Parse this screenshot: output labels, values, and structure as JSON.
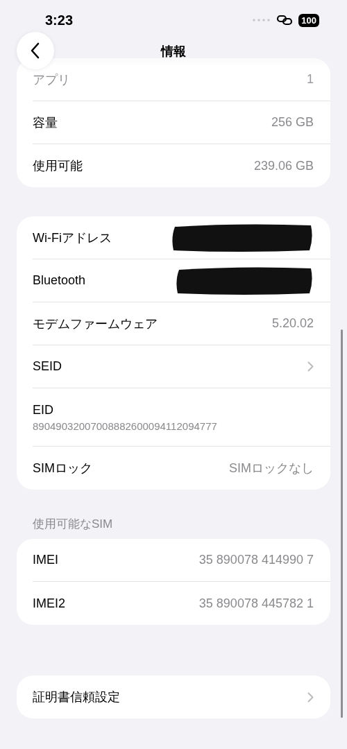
{
  "status_bar": {
    "time": "3:23",
    "battery": "100"
  },
  "nav": {
    "title": "情報"
  },
  "groups": [
    {
      "rows": [
        {
          "kind": "value",
          "label": "アプリ",
          "value": "1",
          "dimmed": true
        },
        {
          "kind": "value",
          "label": "容量",
          "value": "256 GB",
          "dimmed": false
        },
        {
          "kind": "value",
          "label": "使用可能",
          "value": "239.06 GB",
          "dimmed": false
        }
      ]
    },
    {
      "rows": [
        {
          "kind": "redacted",
          "label": "Wi-Fiアドレス",
          "dimmed": false
        },
        {
          "kind": "redacted",
          "label": "Bluetooth",
          "dimmed": false
        },
        {
          "kind": "value",
          "label": "モデムファームウェア",
          "value": "5.20.02",
          "dimmed": false
        },
        {
          "kind": "chevron",
          "label": "SEID",
          "dimmed": false
        },
        {
          "kind": "subtitle",
          "label": "EID",
          "value": "89049032007008882600094112094777",
          "dimmed": false
        },
        {
          "kind": "value",
          "label": "SIMロック",
          "value": "SIMロックなし",
          "dimmed": false
        }
      ]
    },
    {
      "header": "使用可能なSIM",
      "rows": [
        {
          "kind": "value",
          "label": "IMEI",
          "value": "35 890078 414990 7",
          "dimmed": false
        },
        {
          "kind": "value",
          "label": "IMEI2",
          "value": "35 890078 445782 1",
          "dimmed": false
        }
      ]
    },
    {
      "rows": [
        {
          "kind": "chevron",
          "label": "証明書信頼設定",
          "dimmed": false
        }
      ]
    }
  ]
}
